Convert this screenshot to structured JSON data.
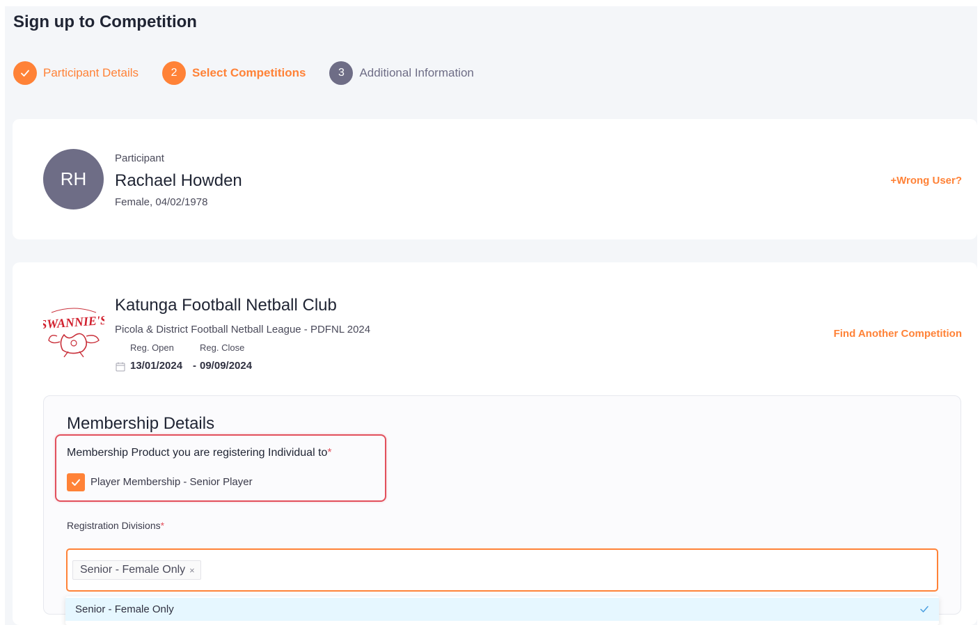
{
  "page": {
    "title": "Sign up to Competition"
  },
  "steps": [
    {
      "number": "",
      "label": "Participant Details",
      "state": "done"
    },
    {
      "number": "2",
      "label": "Select Competitions",
      "state": "active"
    },
    {
      "number": "3",
      "label": "Additional Information",
      "state": "pending"
    }
  ],
  "participant": {
    "caption": "Participant",
    "initials": "RH",
    "name": "Rachael Howden",
    "meta": "Female, 04/02/1978",
    "wrong_user_label": "+Wrong User?"
  },
  "competition": {
    "club_name": "Katunga Football Netball Club",
    "league": "Picola & District Football Netball League - PDFNL 2024",
    "reg_open_label": "Reg. Open",
    "reg_close_label": "Reg. Close",
    "reg_open_date": "13/01/2024",
    "date_separator": "-",
    "reg_close_date": "09/09/2024",
    "find_another_label": "Find Another Competition",
    "logo_text": "SWANNIE'S"
  },
  "membership": {
    "title": "Membership Details",
    "product_label": "Membership Product you are registering Individual to",
    "required_mark": "*",
    "product_option": "Player Membership - Senior Player",
    "product_checked": true,
    "divisions_label": "Registration Divisions",
    "selected_tag": "Senior - Female Only",
    "tag_remove": "×",
    "dropdown_option": "Senior - Female Only"
  },
  "colors": {
    "accent": "#ff8237",
    "pending": "#6e6d86",
    "highlight": "#e2505c",
    "option_selected_bg": "#e6f7ff"
  }
}
